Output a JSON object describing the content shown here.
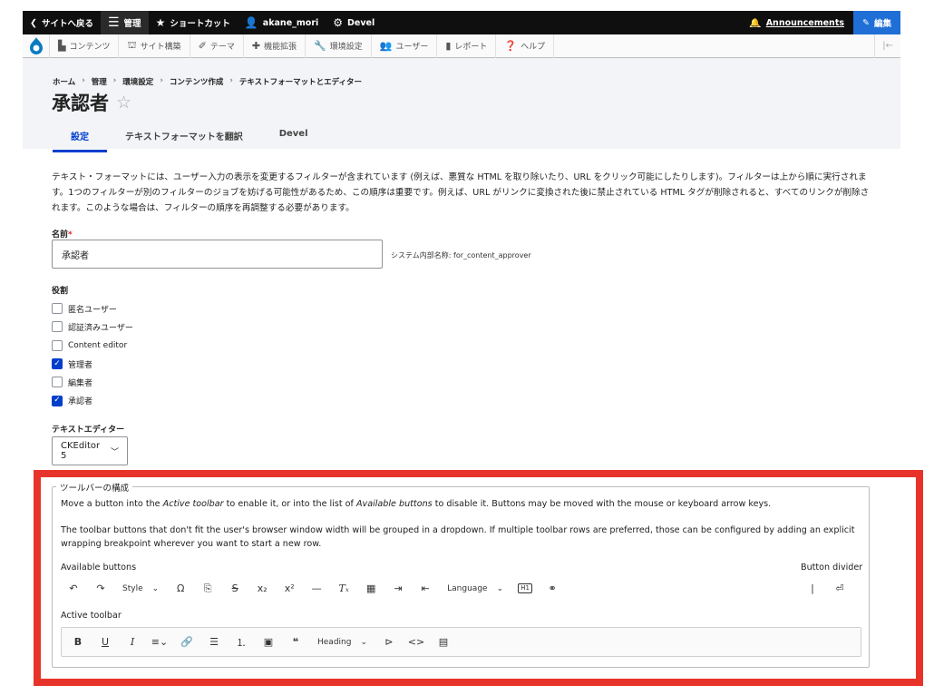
{
  "toolbar": {
    "back": "サイトへ戻る",
    "manage": "管理",
    "shortcuts": "ショートカット",
    "user": "akane_mori",
    "devel": "Devel",
    "announcements": "Announcements",
    "edit": "編集"
  },
  "tray": {
    "items": [
      "コンテンツ",
      "サイト構築",
      "テーマ",
      "機能拡張",
      "環境設定",
      "ユーザー",
      "レポート",
      "ヘルプ"
    ]
  },
  "breadcrumb": [
    "ホーム",
    "管理",
    "環境設定",
    "コンテンツ作成",
    "テキストフォーマットとエディター"
  ],
  "breadcrumb_sep": "›",
  "page_title": "承認者",
  "tabs": [
    "設定",
    "テキストフォーマットを翻訳",
    "Devel"
  ],
  "description": "テキスト・フォーマットには、ユーザー入力の表示を変更するフィルターが含まれています (例えば、悪質な HTML を取り除いたり、URL をクリック可能にしたりします)。フィルターは上から順に実行されます。1つのフィルターが別のフィルターのジョブを妨げる可能性があるため、この順序は重要です。例えば、URL がリンクに変換された後に禁止されている HTML タグが削除されると、すべてのリンクが削除されます。このような場合は、フィルターの順序を再調整する必要があります。",
  "name_field": {
    "label": "名前",
    "required_mark": "*",
    "value": "承認者",
    "machine_name": "システム内部名称: for_content_approver"
  },
  "roles": {
    "label": "役割",
    "items": [
      {
        "label": "匿名ユーザー",
        "checked": false
      },
      {
        "label": "認証済みユーザー",
        "checked": false
      },
      {
        "label": "Content editor",
        "checked": false
      },
      {
        "label": "管理者",
        "checked": true
      },
      {
        "label": "編集者",
        "checked": false
      },
      {
        "label": "承認者",
        "checked": true
      }
    ]
  },
  "editor": {
    "label": "テキストエディター",
    "value": "CKEditor 5"
  },
  "toolbar_config": {
    "legend": "ツールバーの構成",
    "help1_a": "Move a button into the ",
    "help1_b": "Active toolbar",
    "help1_c": " to enable it, or into the list of ",
    "help1_d": "Available buttons",
    "help1_e": " to disable it. Buttons may be moved with the mouse or keyboard arrow keys.",
    "help2": "The toolbar buttons that don't fit the user's browser window width will be grouped in a dropdown. If multiple toolbar rows are preferred, those can be configured by adding an explicit wrapping breakpoint wherever you want to start a new row.",
    "available_label": "Available buttons",
    "divider_label": "Button divider",
    "active_label": "Active toolbar",
    "style_label": "Style",
    "language_label": "Language",
    "heading_label": "Heading"
  }
}
